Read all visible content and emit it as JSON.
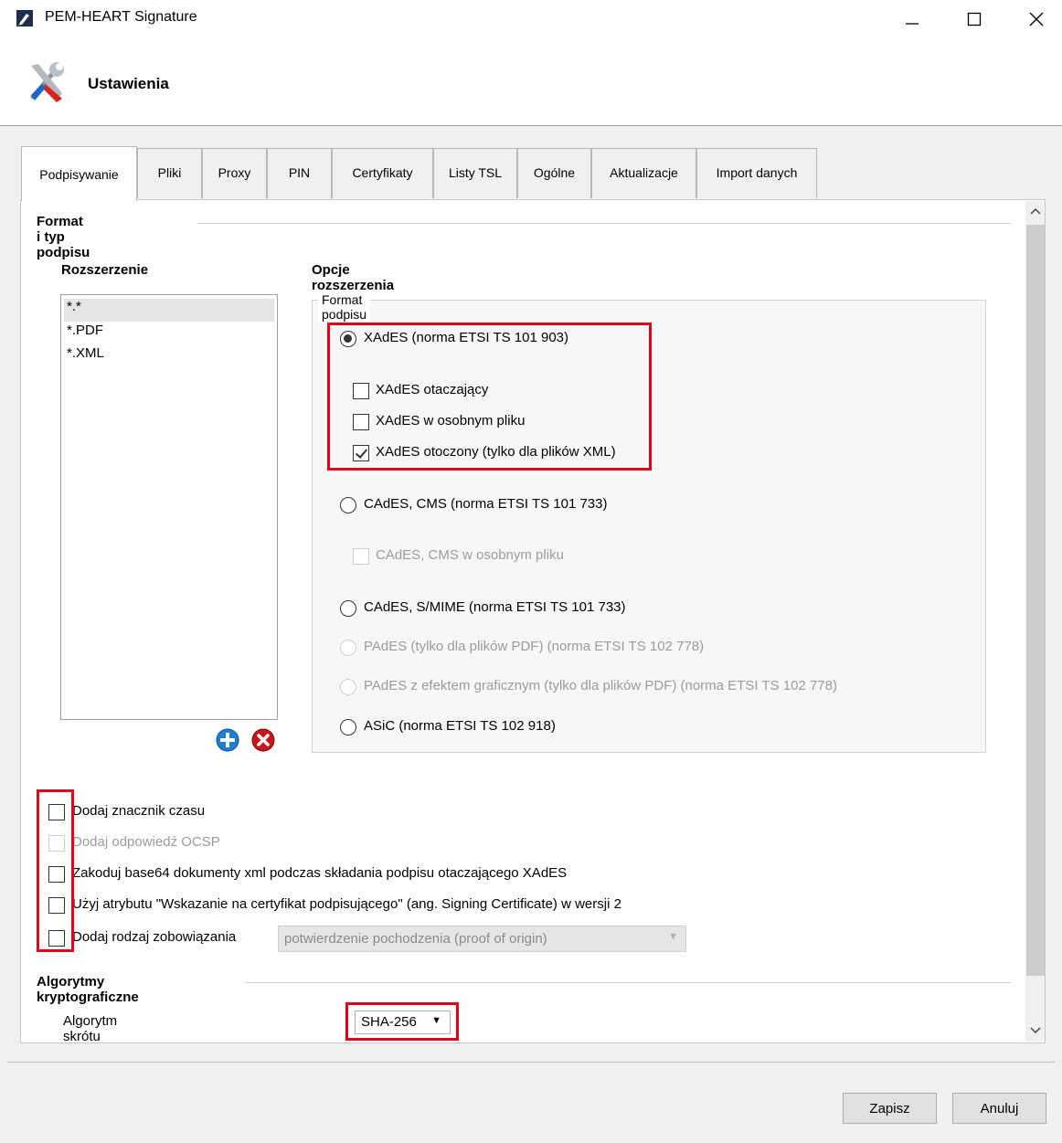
{
  "window": {
    "title": "PEM-HEART Signature",
    "minimize_icon": "minimize-icon",
    "maximize_icon": "maximize-icon",
    "close_icon": "close-icon"
  },
  "header": {
    "title": "Ustawienia",
    "icon": "tools-icon"
  },
  "tabs": [
    {
      "label": "Podpisywanie",
      "active": true
    },
    {
      "label": "Pliki"
    },
    {
      "label": "Proxy"
    },
    {
      "label": "PIN"
    },
    {
      "label": "Certyfikaty"
    },
    {
      "label": "Listy TSL"
    },
    {
      "label": "Ogólne"
    },
    {
      "label": "Aktualizacje"
    },
    {
      "label": "Import danych"
    }
  ],
  "signing": {
    "group_title": "Format i typ podpisu",
    "extensions_heading": "Rozszerzenie",
    "extensions": [
      "*.*",
      "*.PDF",
      "*.XML"
    ],
    "selected_extension": "*.*",
    "add_icon": "add-icon",
    "remove_icon": "remove-icon",
    "options_heading": "Opcje rozszerzenia",
    "format_legend": "Format podpisu",
    "options": [
      {
        "type": "radio",
        "label": "XAdES (norma ETSI TS 101 903)",
        "checked": true,
        "enabled": true
      },
      {
        "type": "checkbox",
        "label": "XAdES otaczający",
        "checked": false,
        "enabled": true
      },
      {
        "type": "checkbox",
        "label": "XAdES w osobnym pliku",
        "checked": false,
        "enabled": true
      },
      {
        "type": "checkbox",
        "label": "XAdES otoczony (tylko dla plików XML)",
        "checked": true,
        "enabled": true
      },
      {
        "type": "radio",
        "label": "CAdES, CMS  (norma ETSI TS 101 733)",
        "checked": false,
        "enabled": true
      },
      {
        "type": "checkbox",
        "label": "CAdES, CMS w osobnym pliku",
        "checked": false,
        "enabled": false
      },
      {
        "type": "radio",
        "label": "CAdES, S/MIME (norma ETSI TS 101 733)",
        "checked": false,
        "enabled": true
      },
      {
        "type": "radio",
        "label": "PAdES  (tylko dla plików PDF) (norma ETSI TS 102 778)",
        "checked": false,
        "enabled": false
      },
      {
        "type": "radio",
        "label": "PAdES  z efektem graficznym (tylko dla plików PDF) (norma ETSI TS 102 778)",
        "checked": false,
        "enabled": false
      },
      {
        "type": "radio",
        "label": "ASiC (norma ETSI TS 102 918)",
        "checked": false,
        "enabled": true
      }
    ],
    "extra_options": [
      {
        "label": "Dodaj znacznik czasu",
        "checked": false,
        "enabled": true
      },
      {
        "label": "Dodaj odpowiedź OCSP",
        "checked": false,
        "enabled": false
      },
      {
        "label": "Zakoduj base64 dokumenty xml podczas składania podpisu otaczającego XAdES",
        "checked": false,
        "enabled": true
      },
      {
        "label": "Użyj atrybutu \"Wskazanie na certyfikat podpisującego\" (ang. Signing Certificate) w wersji 2",
        "checked": false,
        "enabled": true
      },
      {
        "label": "Dodaj rodzaj zobowiązania",
        "checked": false,
        "enabled": true
      }
    ],
    "commitment_value": "potwierdzenie pochodzenia (proof of origin)"
  },
  "crypto": {
    "group_title": "Algorytmy kryptograficzne",
    "hash_label": "Algorytm skrótu",
    "hash_value": "SHA-256"
  },
  "footer": {
    "save_label": "Zapisz",
    "cancel_label": "Anuluj"
  },
  "colors": {
    "highlight": "#e0001b",
    "panel": "#ffffff",
    "background": "#f0f0f0"
  }
}
